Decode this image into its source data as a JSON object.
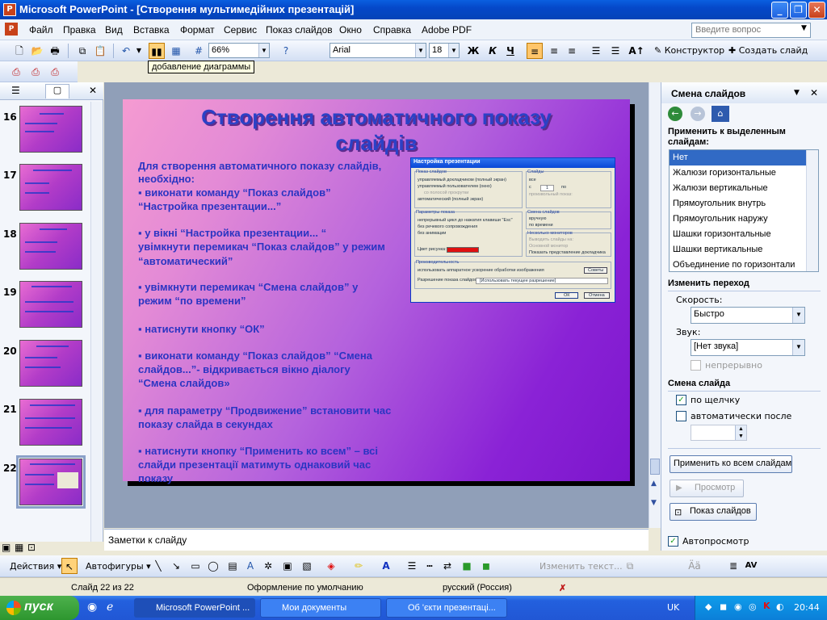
{
  "window": {
    "title": "Microsoft PowerPoint - [Створення мультимедійних презентацій]",
    "app_icon": "P"
  },
  "menu": [
    "Файл",
    "Правка",
    "Вид",
    "Вставка",
    "Формат",
    "Сервис",
    "Показ слайдов",
    "Окно",
    "Справка",
    "Adobe PDF"
  ],
  "help_box": {
    "placeholder": "Введите вопрос"
  },
  "toolbar": {
    "zoom": "66%",
    "font": "Arial",
    "size": "18",
    "bold": "Ж",
    "italic": "К",
    "underline": "Ч",
    "designer": "Конструктор",
    "new_slide": "Создать слайд",
    "tooltip": "добавление диаграммы"
  },
  "thumbnails": [
    {
      "num": "16"
    },
    {
      "num": "17"
    },
    {
      "num": "18"
    },
    {
      "num": "19"
    },
    {
      "num": "20"
    },
    {
      "num": "21"
    },
    {
      "num": "22"
    }
  ],
  "slide": {
    "title_line1": "Створення автоматичного показу",
    "title_line2": "слайдів",
    "lines": [
      "Для створення автоматичного показу слайдів,",
      "необхідно:",
      "▪ виконати команду “Показ слайдов”",
      "“Настройка презентации...”",
      "▪ у вікні “Настройка презентации...   “",
      "  увімкнути перемикач “Показ слайдов” у режим",
      " “автоматический”",
      "▪ увімкнути перемикач “Смена слайдов” у",
      "   режим “по времени”",
      "▪ натиснути  кнопку “ОК”",
      "▪ виконати команду “Показ слайдов”   “Смена",
      "   слайдов...”- відкривається вікно діалогу",
      "  “Смена    слайдов»",
      "▪  для параметру “Продвижение” встановити час",
      "   показу слайда в секундах",
      "▪ натиснути кнопку  “Применить ко всем” – всі",
      "   слайди презентації матимуть однаковий час",
      "   показу"
    ],
    "dialog": {
      "title": "Настройка презентации",
      "show_type": "Показ слайдов",
      "opt1": "управляемый докладчиком (полный экран)",
      "opt2": "управляемый пользователем (окно)",
      "opt2a": "со полосой прокрутки",
      "opt3": "автоматический (полный экран)",
      "slides": "Слайды",
      "all": "все",
      "from": "с",
      "from_val": "1",
      "to": "по",
      "custom": "произвольный показ:",
      "show_params": "Параметры показа",
      "p1": "непрерывный цикл до нажатия клавиши \"Esc\"",
      "p2": "без речевого сопровождения",
      "p3": "без анимации",
      "pen": "Цвет рисунка:",
      "advance": "Смена слайдов",
      "manual": "вручную",
      "timed": "по времени",
      "monitors": "Несколько мониторов",
      "show_on": "Выводить слайды на:",
      "primary": "Основной монитор",
      "presenter": "Показать представление докладчика",
      "perf": "Производительность",
      "accel": "использовать аппаратное ускорение обработки изображения",
      "tips": "Советы",
      "res": "Разрешение показа слайдов:",
      "res_val": "[Использовать текущее разрешение]",
      "ok": "ОК",
      "cancel": "Отмена"
    }
  },
  "notes": {
    "placeholder": "Заметки к слайду"
  },
  "taskpane": {
    "title": "Смена слайдов",
    "apply_label_1": "Применить к выделенным",
    "apply_label_2": "слайдам:",
    "transitions": [
      "Нет",
      "Жалюзи горизонтальные",
      "Жалюзи вертикальные",
      "Прямоугольник внутрь",
      "Прямоугольник наружу",
      "Шашки горизонтальные",
      "Шашки вертикальные",
      "Объединение по горизонтали"
    ],
    "change_label": "Изменить переход",
    "speed_label": "Скорость:",
    "speed": "Быстро",
    "sound_label": "Звук:",
    "sound": "[Нет звука]",
    "loop": "непрерывно",
    "advance_label": "Смена слайда",
    "on_click": "по щелчку",
    "auto_after": "автоматически после",
    "apply_all": "Применить ко всем слайдам",
    "preview": "Просмотр",
    "slideshow": "Показ слайдов",
    "autopreview": "Автопросмотр"
  },
  "drawbar": {
    "actions": "Действия",
    "autoshapes": "Автофигуры",
    "edit_text": "Изменить текст..."
  },
  "status": {
    "slide": "Слайд 22 из 22",
    "design": "Оформление по умолчанию",
    "lang": "русский (Россия)"
  },
  "taskbar": {
    "start": "пуск",
    "tasks": [
      "Microsoft PowerPoint ...",
      "Мои документы",
      "Об 'єкти презентаці..."
    ],
    "lang": "UK",
    "time": "20:44"
  }
}
